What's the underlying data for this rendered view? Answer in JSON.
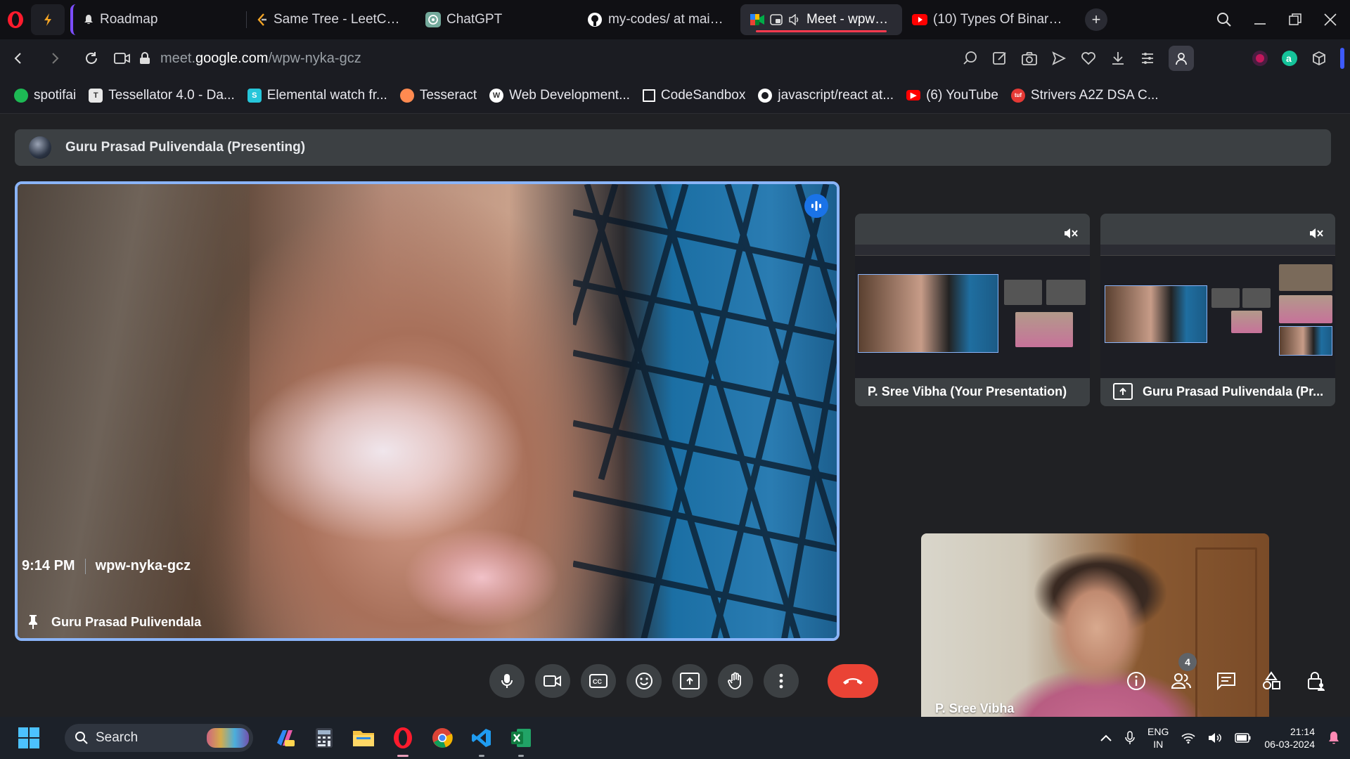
{
  "browser": {
    "tabs": [
      {
        "label": "Roadmap",
        "icon": "bell-icon"
      },
      {
        "label": "Same Tree - LeetCode",
        "icon": "leetcode-icon"
      },
      {
        "label": "ChatGPT",
        "icon": "chatgpt-icon"
      },
      {
        "label": "my-codes/ at main · Sre",
        "icon": "github-icon"
      },
      {
        "label": "Meet - wpw-nyka",
        "icon": "meet-icon",
        "active": true
      },
      {
        "label": "(10) Types Of Binary Tre",
        "icon": "youtube-icon"
      }
    ],
    "new_tab_label": "+",
    "url_path_prefix": "meet.",
    "url_domain": "google.com",
    "url_path": "/wpw-nyka-gcz",
    "bookmarks": [
      {
        "label": "spotifai",
        "color": "#1db954"
      },
      {
        "label": "Tessellator 4.0 - Da...",
        "color": "#e8e8e8"
      },
      {
        "label": "Elemental watch fr...",
        "color": "#26c6da"
      },
      {
        "label": "Tesseract",
        "color": "#ff8a50"
      },
      {
        "label": "Web Development...",
        "color": "#ffffff"
      },
      {
        "label": "CodeSandbox",
        "color": "#ffffff"
      },
      {
        "label": "javascript/react at...",
        "color": "#ffffff"
      },
      {
        "label": "(6) YouTube",
        "color": "#ff0000"
      },
      {
        "label": "Strivers A2Z DSA C...",
        "color": "#e53935"
      }
    ]
  },
  "meet": {
    "presenting_title": "Guru Prasad Pulivendala (Presenting)",
    "main_tile_name": "Guru Prasad Pulivendala",
    "thumbnails": [
      {
        "label": "P. Sree Vibha (Your Presentation)"
      },
      {
        "label": "Guru Prasad Pulivendala (Pr..."
      }
    ],
    "self_name": "P. Sree Vibha",
    "time": "9:14 PM",
    "meeting_code": "wpw-nyka-gcz",
    "participant_count": "4",
    "colors": {
      "accent": "#8ab4f8",
      "end_call": "#ea4335",
      "speaking": "#1a73e8"
    }
  },
  "taskbar": {
    "search_placeholder": "Search",
    "lang_top": "ENG",
    "lang_bottom": "IN",
    "clock_time": "21:14",
    "clock_date": "06-03-2024"
  }
}
